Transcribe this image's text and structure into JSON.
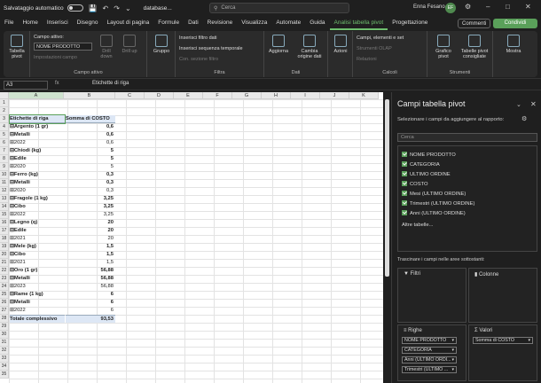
{
  "titlebar": {
    "autosave_label": "Salvataggio automatico",
    "file_name": "databasе...",
    "search_placeholder": "Cerca",
    "user_name": "Enna Fesano",
    "user_initials": "EF"
  },
  "tabs": [
    "File",
    "Home",
    "Inserisci",
    "Disegno",
    "Layout di pagina",
    "Formule",
    "Dati",
    "Revisione",
    "Visualizza",
    "Automate",
    "Guida",
    "Analisi tabella pivot",
    "Progettazione"
  ],
  "active_tab": "Analisi tabella pivot",
  "buttons": {
    "comments": "Commenti",
    "share": "Condividi"
  },
  "ribbon": {
    "pivot_label": "Tabella pivot",
    "active_field_title": "Campo attivo:",
    "active_field_value": "NOME PRODOTTO",
    "field_settings": "Impostazioni campo",
    "drill_down": "Drill down",
    "drill_up": "Drill up",
    "group_label": "Gruppo",
    "group_active_field": "Campo attivo",
    "insert_slicer": "Inserisci filtro dati",
    "insert_timeline": "Inserisci sequenza temporale",
    "filter_connections": "Con. sezione filtro",
    "group_filter": "Filtra",
    "refresh": "Aggiorna",
    "change_source": "Cambia origine dati",
    "group_data": "Dati",
    "actions": "Azioni",
    "fields_items": "Campi, elementi e set",
    "olap": "Strumenti OLAP",
    "relations": "Relazioni",
    "group_calc": "Calcoli",
    "pivot_chart": "Grafico pivot",
    "recommended": "Tabelle pivot consigliate",
    "group_tools": "Strumenti",
    "show": "Mostra"
  },
  "formula": {
    "cell_ref": "A3",
    "fx": "fx",
    "content": "Etichette di riga"
  },
  "columns": [
    "A",
    "B",
    "C",
    "D",
    "E",
    "F",
    "G",
    "H",
    "I",
    "J",
    "K"
  ],
  "rows": [
    {
      "n": "1",
      "a": "",
      "b": ""
    },
    {
      "n": "2",
      "a": "",
      "b": ""
    },
    {
      "n": "3",
      "a": "Etichette di riga",
      "b": "Somma di COSTO",
      "style": "head"
    },
    {
      "n": "4",
      "a": "⊟Argento (1 gr)",
      "b": "0,6",
      "style": "bold"
    },
    {
      "n": "5",
      "a": "  ⊟Metalli",
      "b": "0,6",
      "style": "bold"
    },
    {
      "n": "6",
      "a": "     ⊞2022",
      "b": "0,6"
    },
    {
      "n": "7",
      "a": "⊟Chiodi (kg)",
      "b": "5",
      "style": "bold"
    },
    {
      "n": "8",
      "a": "  ⊟Edile",
      "b": "5",
      "style": "bold"
    },
    {
      "n": "9",
      "a": "     ⊞2020",
      "b": "5"
    },
    {
      "n": "10",
      "a": "⊟Ferro (kg)",
      "b": "0,3",
      "style": "bold"
    },
    {
      "n": "11",
      "a": "  ⊟Metalli",
      "b": "0,3",
      "style": "bold"
    },
    {
      "n": "12",
      "a": "     ⊞2020",
      "b": "0,3"
    },
    {
      "n": "13",
      "a": "⊟Fragole (1 kg)",
      "b": "3,25",
      "style": "bold"
    },
    {
      "n": "14",
      "a": "  ⊟Cibo",
      "b": "3,25",
      "style": "bold"
    },
    {
      "n": "15",
      "a": "     ⊞2022",
      "b": "3,25"
    },
    {
      "n": "16",
      "a": "⊟Legno (q)",
      "b": "20",
      "style": "bold"
    },
    {
      "n": "17",
      "a": "  ⊟Edile",
      "b": "20",
      "style": "bold"
    },
    {
      "n": "18",
      "a": "     ⊞2021",
      "b": "20"
    },
    {
      "n": "19",
      "a": "⊟Mele (kg)",
      "b": "1,5",
      "style": "bold"
    },
    {
      "n": "20",
      "a": "  ⊟Cibo",
      "b": "1,5",
      "style": "bold"
    },
    {
      "n": "21",
      "a": "     ⊞2021",
      "b": "1,5"
    },
    {
      "n": "22",
      "a": "⊟Oro (1 gr)",
      "b": "56,88",
      "style": "bold"
    },
    {
      "n": "23",
      "a": "  ⊟Metalli",
      "b": "56,88",
      "style": "bold"
    },
    {
      "n": "24",
      "a": "     ⊞2023",
      "b": "56,88"
    },
    {
      "n": "25",
      "a": "⊟Rame (1 kg)",
      "b": "6",
      "style": "bold"
    },
    {
      "n": "26",
      "a": "  ⊟Metalli",
      "b": "6",
      "style": "bold"
    },
    {
      "n": "27",
      "a": "     ⊞2022",
      "b": "6"
    },
    {
      "n": "28",
      "a": "Totale complessivo",
      "b": "93,53",
      "style": "total"
    },
    {
      "n": "29",
      "a": "",
      "b": ""
    },
    {
      "n": "30",
      "a": "",
      "b": ""
    },
    {
      "n": "31",
      "a": "",
      "b": ""
    },
    {
      "n": "32",
      "a": "",
      "b": ""
    },
    {
      "n": "33",
      "a": "",
      "b": ""
    },
    {
      "n": "34",
      "a": "",
      "b": ""
    },
    {
      "n": "35",
      "a": "",
      "b": ""
    }
  ],
  "pane": {
    "title": "Campi tabella pivot",
    "subtitle": "Selezionare i campi da aggiungere al rapporto:",
    "search_placeholder": "Cerca",
    "fields": [
      "NOME PRODOTTO",
      "CATEGORIA",
      "ULTIMO ORDINE",
      "COSTO",
      "Mesi (ULTIMO ORDINE)",
      "Trimestri (ULTIMO ORDINE)",
      "Anni (ULTIMO ORDINE)"
    ],
    "more_tables": "Altre tabelle...",
    "drag_note": "Trascinare i campi nelle aree sottostanti:",
    "filters_title": "Filtri",
    "columns_title": "Colonne",
    "rows_title": "Righe",
    "values_title": "Valori",
    "row_items": [
      "NOME PRODOTTO",
      "CATEGORIA",
      "Anni (ULTIMO ORDI...",
      "Trimestri (ULTIMO ..."
    ],
    "value_items": [
      "Somma di COSTO"
    ]
  },
  "colors": {
    "accent": "#5aa05a",
    "pivot_header": "#dde7f5"
  }
}
